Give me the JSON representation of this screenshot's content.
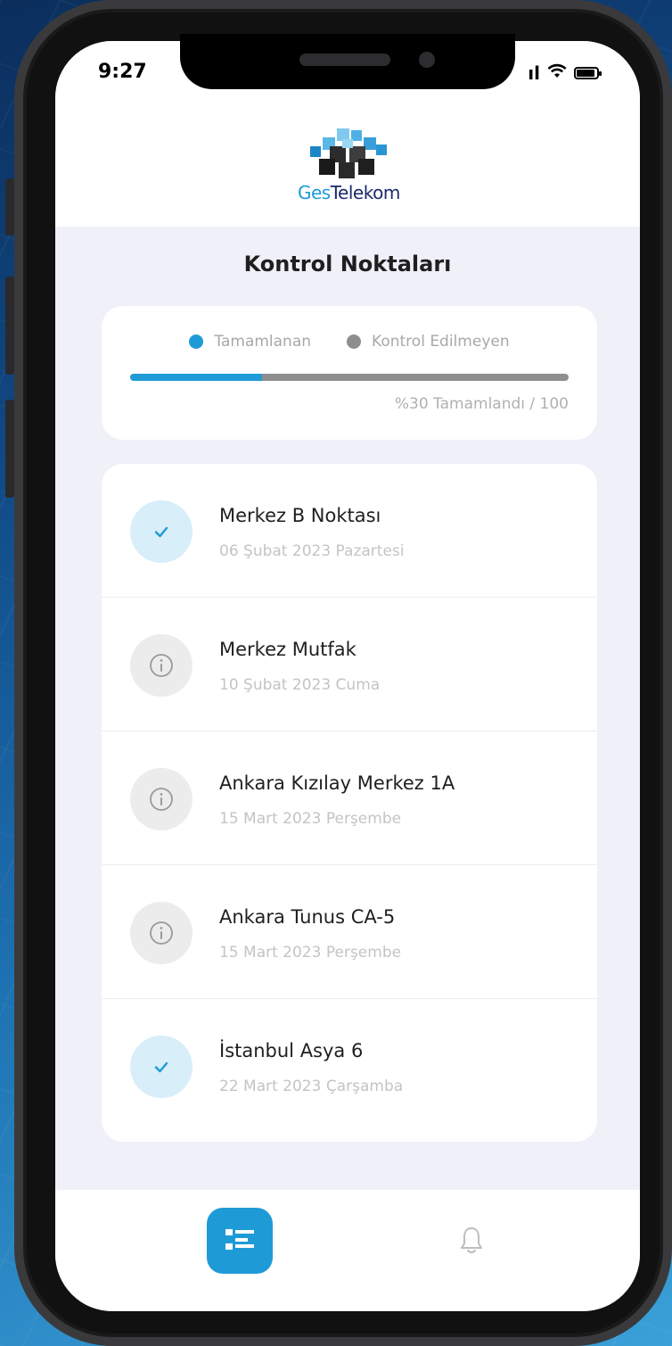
{
  "status_bar": {
    "time": "9:27"
  },
  "logo": {
    "part1": "Ges",
    "part2": "Telekom"
  },
  "page": {
    "title": "Kontrol Noktaları"
  },
  "progress": {
    "legend_completed": "Tamamlanan",
    "legend_unchecked": "Kontrol Edilmeyen",
    "caption": "%30 Tamamlandı / 100",
    "percent": 30,
    "colors": {
      "completed": "#1e9bd7",
      "unchecked": "#8e8e8e"
    }
  },
  "checkpoints": [
    {
      "title": "Merkez B Noktası",
      "date": "06 Şubat 2023 Pazartesi",
      "status": "done",
      "icon": "check-icon"
    },
    {
      "title": "Merkez Mutfak",
      "date": "10 Şubat 2023 Cuma",
      "status": "pending",
      "icon": "info-icon"
    },
    {
      "title": "Ankara Kızılay Merkez 1A",
      "date": "15 Mart 2023 Perşembe",
      "status": "pending",
      "icon": "info-icon"
    },
    {
      "title": "Ankara Tunus CA-5",
      "date": "15 Mart 2023 Perşembe",
      "status": "pending",
      "icon": "info-icon"
    },
    {
      "title": "İstanbul Asya 6",
      "date": "22 Mart 2023 Çarşamba",
      "status": "done",
      "icon": "check-icon"
    }
  ],
  "nav": {
    "items": [
      "list-icon",
      "bell-icon"
    ]
  }
}
